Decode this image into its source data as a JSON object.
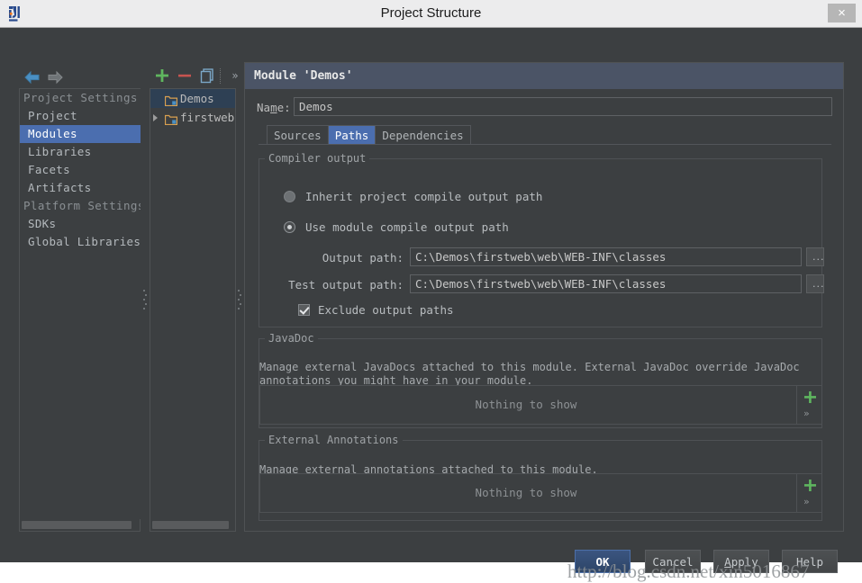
{
  "window": {
    "title": "Project Structure",
    "logo_icon": "intellij-idea-logo",
    "close_label": "×"
  },
  "toolbar": {
    "back_icon": "arrow-left-icon",
    "forward_icon": "arrow-right-icon",
    "add_icon": "plus-icon",
    "remove_icon": "minus-icon",
    "copy_icon": "copy-icon",
    "more_label": "»"
  },
  "sidebar": {
    "groups": [
      {
        "header": "Project Settings",
        "items": [
          {
            "label": "Project",
            "selected": false
          },
          {
            "label": "Modules",
            "selected": true
          },
          {
            "label": "Libraries",
            "selected": false
          },
          {
            "label": "Facets",
            "selected": false
          },
          {
            "label": "Artifacts",
            "selected": false
          }
        ]
      },
      {
        "header": "Platform Settings",
        "items": [
          {
            "label": "SDKs",
            "selected": false
          },
          {
            "label": "Global Libraries",
            "selected": false
          }
        ]
      }
    ]
  },
  "module_tree": {
    "items": [
      {
        "label": "Demos",
        "selected": true,
        "has_arrow": false,
        "icon": "module-folder-icon"
      },
      {
        "label": "firstweb",
        "selected": false,
        "has_arrow": true,
        "icon": "module-folder-icon"
      }
    ]
  },
  "detail": {
    "header": "Module 'Demos'",
    "name_label_pre": "Na",
    "name_label_mnemonic": "m",
    "name_label_post": "e:",
    "name_value": "Demos",
    "tabs": [
      {
        "label": "Sources",
        "active": false
      },
      {
        "label": "Paths",
        "active": true
      },
      {
        "label": "Dependencies",
        "active": false
      }
    ]
  },
  "compiler_output": {
    "group_title": "Compiler output",
    "radio_inherit_label": "Inherit project compile output path",
    "radio_inherit_selected": false,
    "radio_module_label": "Use module compile output path",
    "radio_module_selected": true,
    "output_path_label": "Output path:",
    "output_path_value": "C:\\Demos\\firstweb\\web\\WEB-INF\\classes",
    "test_output_path_label": "Test output path:",
    "test_output_path_value": "C:\\Demos\\firstweb\\web\\WEB-INF\\classes",
    "browse_label": "...",
    "exclude_checkbox_label": "Exclude output paths",
    "exclude_checked": true
  },
  "javadoc": {
    "group_title": "JavaDoc",
    "description": "Manage external JavaDocs attached to this module. External JavaDoc override JavaDoc annotations you might have in your module.",
    "empty_text": "Nothing to show",
    "add_icon": "plus-icon",
    "more_label": "»"
  },
  "external_annotations": {
    "group_title": "External Annotations",
    "description": "Manage external annotations attached to this module.",
    "empty_text": "Nothing to show",
    "add_icon": "plus-icon",
    "more_label": "»"
  },
  "buttons": {
    "ok": "OK",
    "cancel": "Cancel",
    "apply_pre": "",
    "apply_mnemonic": "A",
    "apply_post": "pply",
    "help": "Help"
  },
  "watermark": "http://blog.csdn.net/xin5016867",
  "colors": {
    "dialog_bg": "#3c3f41",
    "titlebar_bg": "#ececed",
    "accent_blue": "#4b6eaf",
    "header_blue": "#4b5466",
    "tree_selected": "#2e4054",
    "add_green": "#5fb65f",
    "remove_red": "#c75450"
  }
}
